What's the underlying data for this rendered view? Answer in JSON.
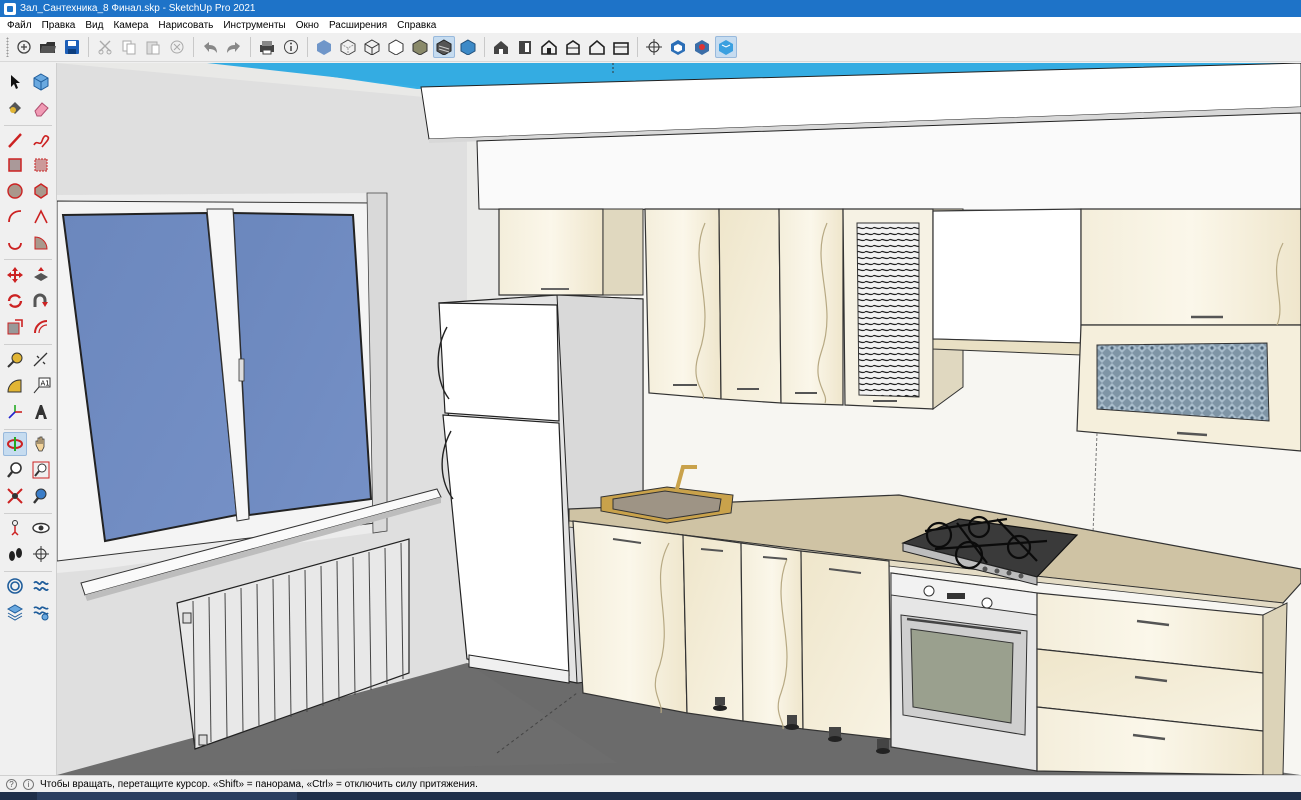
{
  "window": {
    "title": "Зал_Сантехника_8 Финал.skp - SketchUp Pro 2021"
  },
  "menu": [
    "Файл",
    "Правка",
    "Вид",
    "Камера",
    "Нарисовать",
    "Инструменты",
    "Окно",
    "Расширения",
    "Справка"
  ],
  "toolbar": {
    "groups": [
      [
        "new-icon",
        "open-icon",
        "save-icon"
      ],
      [
        "cut-icon",
        "copy-icon",
        "paste-icon",
        "erase-icon"
      ],
      [
        "undo-icon",
        "redo-icon",
        "print-icon",
        "model-info-icon"
      ],
      [
        "xray-icon",
        "back-edges-icon",
        "wireframe-icon",
        "hidden-line-icon",
        "shaded-icon",
        "shaded-textures-icon",
        "monochrome-icon"
      ],
      [
        "iso-view-icon",
        "top-view-icon",
        "front-view-icon",
        "right-view-icon",
        "back-view-icon",
        "left-view-icon"
      ],
      [
        "section-plane-icon",
        "warehouse-icon",
        "extension-warehouse-icon",
        "layout-icon"
      ]
    ],
    "active": "shaded-textures-icon"
  },
  "tools": [
    [
      "select-icon",
      "component-icon"
    ],
    [
      "paint-bucket-icon",
      "eraser-icon"
    ],
    [
      "line-icon",
      "freehand-icon"
    ],
    [
      "rectangle-icon",
      "rotated-rectangle-icon"
    ],
    [
      "circle-icon",
      "polygon-icon"
    ],
    [
      "arc-icon",
      "2point-arc-icon"
    ],
    [
      "3point-arc-icon",
      "pie-icon"
    ],
    [
      "move-icon",
      "push-pull-icon"
    ],
    [
      "rotate-icon",
      "follow-me-icon"
    ],
    [
      "scale-icon",
      "offset-icon"
    ],
    [
      "tape-measure-icon",
      "dimension-icon"
    ],
    [
      "protractor-icon",
      "text-icon"
    ],
    [
      "axes-icon",
      "3d-text-icon"
    ],
    [
      "orbit-icon",
      "pan-icon"
    ],
    [
      "zoom-icon",
      "zoom-window-icon"
    ],
    [
      "zoom-extents-icon",
      "previous-view-icon"
    ],
    [
      "position-camera-icon",
      "look-around-icon"
    ],
    [
      "walk-icon",
      "section-icon"
    ],
    [
      "sandbox-from-contours-icon",
      "sandbox-from-scratch-icon"
    ],
    [
      "smoove-icon",
      "stamp-icon"
    ]
  ],
  "tools_active": "orbit-icon",
  "status": {
    "text": "Чтобы вращать, перетащите курсор. «Shift» = панорама, «Ctrl» = отключить силу притяжения."
  },
  "colors": {
    "titlebar": "#1e73c8",
    "ceiling": "#36b0e6",
    "window_glass": "#6f8cbf",
    "cabinet": "#f3ecd6",
    "countertop": "#cfc3a4"
  }
}
